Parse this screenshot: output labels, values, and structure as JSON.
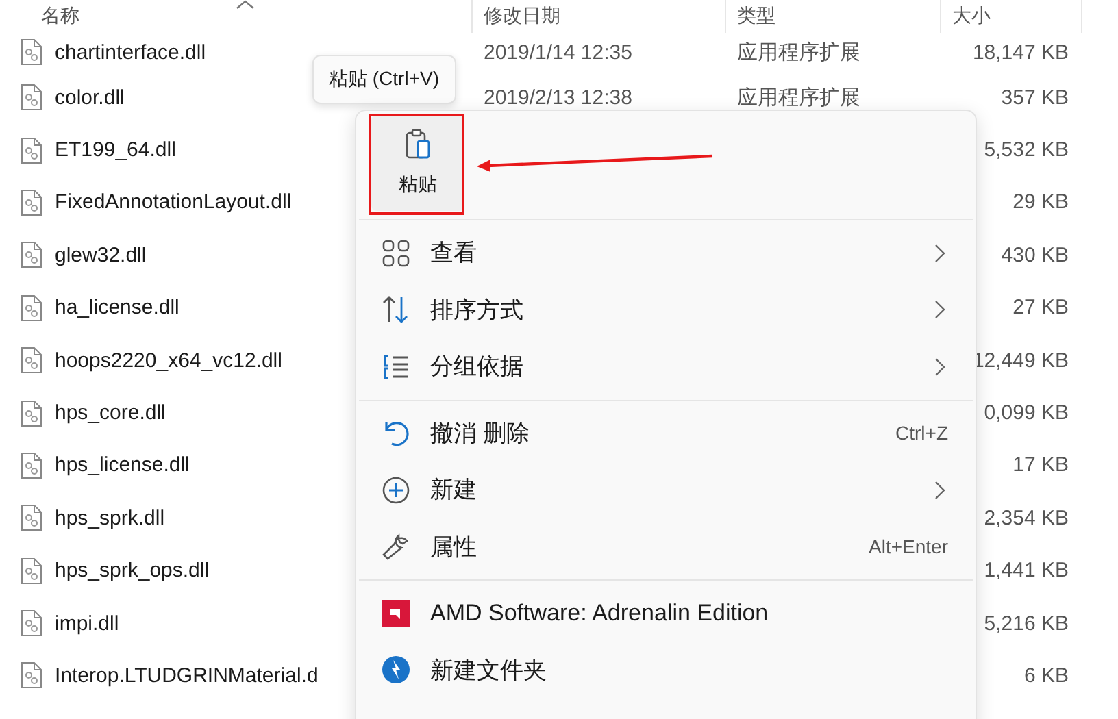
{
  "columns": [
    {
      "label": "名称",
      "sorted": true
    },
    {
      "label": "修改日期",
      "sorted": false
    },
    {
      "label": "类型",
      "sorted": false
    },
    {
      "label": "大小",
      "sorted": false
    }
  ],
  "rows": [
    {
      "name": "chartinterface.dll",
      "date": "2019/1/14 12:35",
      "type": "应用程序扩展",
      "size": "18,147 KB"
    },
    {
      "name": "color.dll",
      "date": "2019/2/13 12:38",
      "type": "应用程序扩展",
      "size": "357 KB"
    },
    {
      "name": "ET199_64.dll",
      "size": "5,532 KB"
    },
    {
      "name": "FixedAnnotationLayout.dll",
      "size": "29 KB"
    },
    {
      "name": "glew32.dll",
      "size": "430 KB"
    },
    {
      "name": "ha_license.dll",
      "size": "27 KB"
    },
    {
      "name": "hoops2220_x64_vc12.dll",
      "size": "12,449 KB"
    },
    {
      "name": "hps_core.dll",
      "size": "0,099 KB"
    },
    {
      "name": "hps_license.dll",
      "size": "17 KB"
    },
    {
      "name": "hps_sprk.dll",
      "size": "2,354 KB"
    },
    {
      "name": "hps_sprk_ops.dll",
      "size": "1,441 KB"
    },
    {
      "name": "impi.dll",
      "size": "5,216 KB"
    },
    {
      "name": "Interop.LTUDGRINMaterial.d",
      "size": "6 KB"
    }
  ],
  "tooltip": "粘贴 (Ctrl+V)",
  "context_menu": {
    "top_actions": [
      {
        "label": "粘贴"
      }
    ],
    "items": [
      {
        "kind": "submenu",
        "label": "查看"
      },
      {
        "kind": "submenu",
        "label": "排序方式"
      },
      {
        "kind": "submenu",
        "label": "分组依据"
      },
      {
        "kind": "separator"
      },
      {
        "kind": "shortcut",
        "label": "撤消 删除",
        "shortcut": "Ctrl+Z"
      },
      {
        "kind": "submenu",
        "label": "新建"
      },
      {
        "kind": "shortcut",
        "label": "属性",
        "shortcut": "Alt+Enter"
      },
      {
        "kind": "separator"
      },
      {
        "kind": "plain",
        "label": "AMD Software: Adrenalin Edition"
      },
      {
        "kind": "plain",
        "label": "新建文件夹"
      }
    ]
  }
}
